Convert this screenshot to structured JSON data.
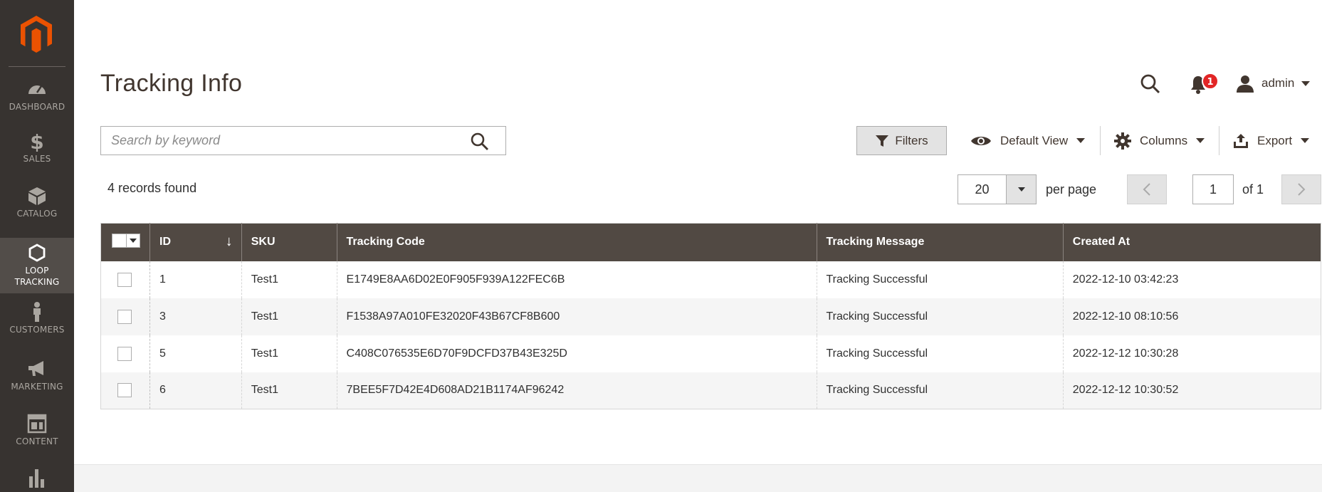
{
  "sidebar": {
    "items": [
      {
        "label": "DASHBOARD",
        "icon": "dashboard-icon"
      },
      {
        "label": "SALES",
        "icon": "dollar-icon"
      },
      {
        "label": "CATALOG",
        "icon": "box-icon"
      },
      {
        "label": "LOOP",
        "label2": "TRACKING",
        "icon": "hexagon-icon",
        "active": true
      },
      {
        "label": "CUSTOMERS",
        "icon": "person-icon"
      },
      {
        "label": "MARKETING",
        "icon": "megaphone-icon"
      },
      {
        "label": "CONTENT",
        "icon": "layout-icon"
      },
      {
        "label": "",
        "icon": "bar-chart-icon"
      }
    ]
  },
  "header": {
    "title": "Tracking Info",
    "notifications_count": "1",
    "user_name": "admin"
  },
  "toolbar": {
    "search_placeholder": "Search by keyword",
    "filters_label": "Filters",
    "view_label": "Default View",
    "columns_label": "Columns",
    "export_label": "Export"
  },
  "pager": {
    "records_found": "4 records found",
    "per_page_value": "20",
    "per_page_label": "per page",
    "current_page": "1",
    "of_total": "of 1"
  },
  "grid": {
    "columns": [
      "ID",
      "SKU",
      "Tracking Code",
      "Tracking Message",
      "Created At"
    ],
    "rows": [
      {
        "id": "1",
        "sku": "Test1",
        "code": "E1749E8AA6D02E0F905F939A122FEC6B",
        "message": "Tracking Successful",
        "created": "2022-12-10 03:42:23"
      },
      {
        "id": "3",
        "sku": "Test1",
        "code": "F1538A97A010FE32020F43B67CF8B600",
        "message": "Tracking Successful",
        "created": "2022-12-10 08:10:56"
      },
      {
        "id": "5",
        "sku": "Test1",
        "code": "C408C076535E6D70F9DCFD37B43E325D",
        "message": "Tracking Successful",
        "created": "2022-12-12 10:30:28"
      },
      {
        "id": "6",
        "sku": "Test1",
        "code": "7BEE5F7D42E4D608AD21B1174AF96242",
        "message": "Tracking Successful",
        "created": "2022-12-12 10:30:52"
      }
    ]
  },
  "colors": {
    "sidebar_bg": "#373330",
    "sidebar_active": "#524d49",
    "header_row": "#514943",
    "brand_orange": "#eb5202",
    "badge_red": "#e22626"
  }
}
